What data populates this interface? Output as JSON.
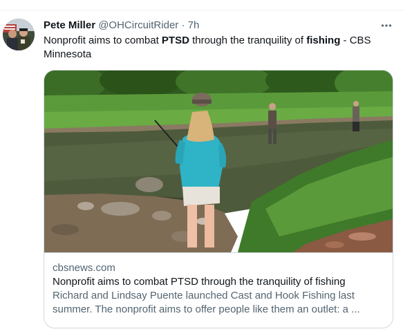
{
  "tweet": {
    "author_name": "Pete Miller",
    "handle": "@OHCircuitRider",
    "separator": "·",
    "time": "7h",
    "text_parts": [
      {
        "text": "Nonprofit aims to combat ",
        "bold": false
      },
      {
        "text": "PTSD",
        "bold": true
      },
      {
        "text": " through the tranquility of ",
        "bold": false
      },
      {
        "text": "fishing",
        "bold": true
      },
      {
        "text": " - CBS Minnesota",
        "bold": false
      }
    ]
  },
  "card": {
    "domain": "cbsnews.com",
    "title": "Nonprofit aims to combat PTSD through the tranquility of fishing",
    "description": "Richard and Lindsay Puente launched Cast and Hook Fishing last summer. The nonprofit aims to offer people like them an outlet: a ..."
  },
  "icons": {
    "more": "more-horizontal-icon"
  },
  "colors": {
    "text_primary": "#0f1419",
    "text_secondary": "#536471",
    "border": "#cfd9de"
  }
}
